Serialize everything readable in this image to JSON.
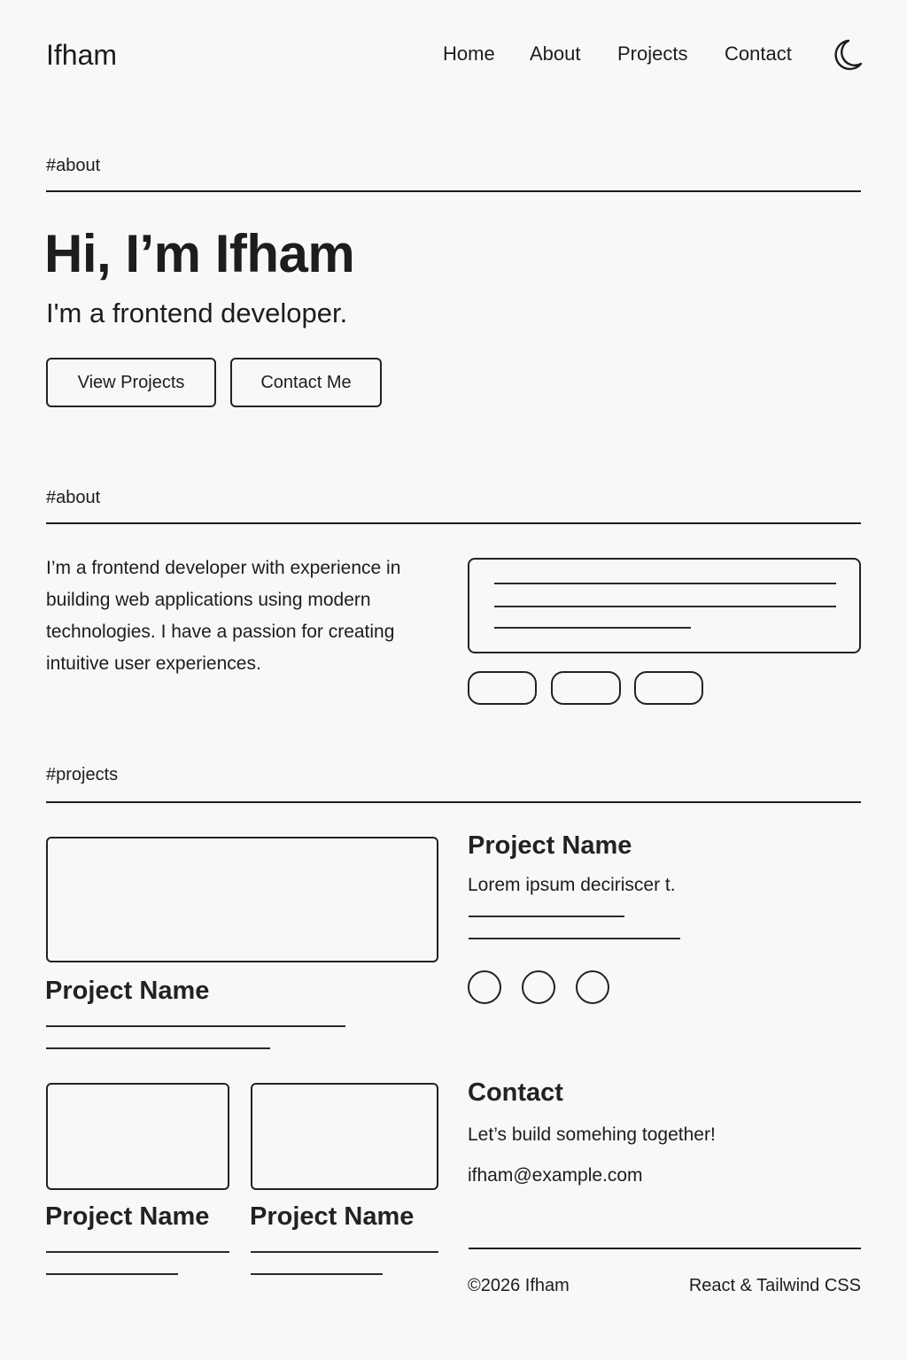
{
  "header": {
    "brand": "Ifham",
    "nav": [
      "Home",
      "About",
      "Projects",
      "Contact"
    ],
    "theme_toggle_icon": "moon-icon"
  },
  "hero": {
    "section_label": "#about",
    "title": "Hi, I’m Ifham",
    "subtitle": "I'm a frontend developer.",
    "primary_button": "View Projects",
    "secondary_button": "Contact Me"
  },
  "about": {
    "section_label": "#about",
    "paragraph": "I’m a frontend developer with experience in building web applications using modern technologies. I have a passion for creating intuitive user experiences."
  },
  "projects": {
    "section_label": "#projects",
    "featured": {
      "title": "Project Name",
      "description": "Lorem ipsum deciriscer t."
    },
    "cards": [
      {
        "title": "Project Name"
      },
      {
        "title": "Project Name"
      },
      {
        "title": "Project Name"
      }
    ]
  },
  "contact": {
    "title": "Contact",
    "tagline": "Let’s build somehing together!",
    "email": "ifham@example.com"
  },
  "footer": {
    "copyright": "©2026 Ifham",
    "stack": "React & Tailwind CSS"
  },
  "colors": {
    "background": "#f8f8f8",
    "ink": "#1d1d1d"
  }
}
